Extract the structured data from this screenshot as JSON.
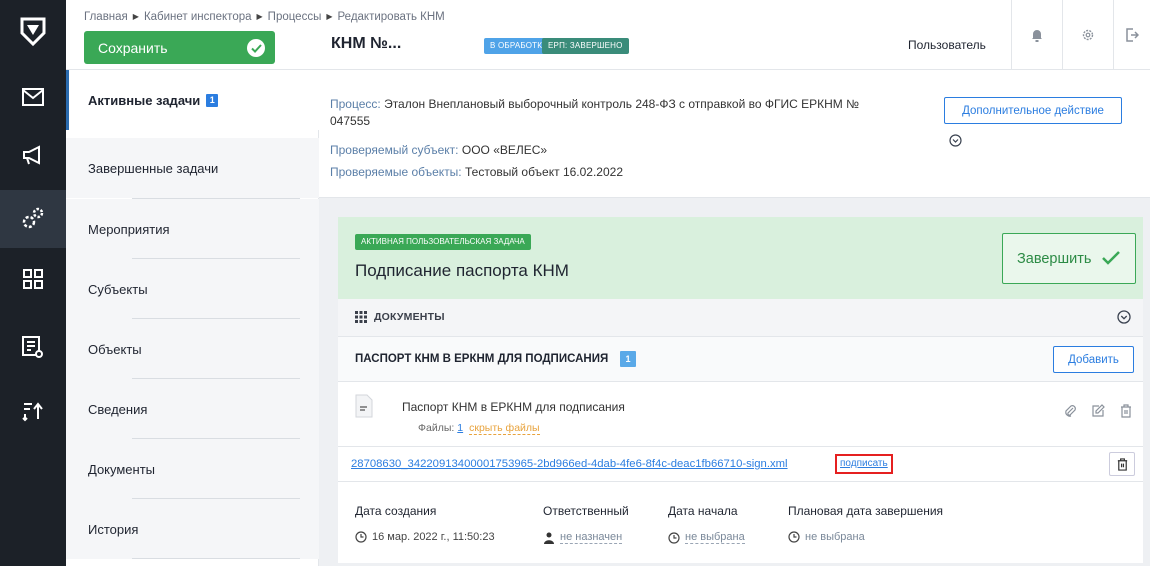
{
  "breadcrumb": [
    "Главная",
    "Кабинет инспектора",
    "Процессы",
    "Редактировать КНМ"
  ],
  "header": {
    "save_label": "Сохранить",
    "title": "КНМ №...",
    "badge_status": "В ОБРАБОТКЕ",
    "badge_erp": "ЕРП: ЗАВЕРШЕНО",
    "user": "Пользователь"
  },
  "rail_icons": [
    "logo-icon",
    "mail-icon",
    "megaphone-icon",
    "gears-icon",
    "grid-icon",
    "report-icon",
    "sort-icon"
  ],
  "nav": [
    {
      "label": "Активные задачи",
      "count": "1"
    },
    {
      "label": "Завершенные задачи"
    },
    {
      "label": "Мероприятия"
    },
    {
      "label": "Субъекты"
    },
    {
      "label": "Объекты"
    },
    {
      "label": "Сведения"
    },
    {
      "label": "Документы"
    },
    {
      "label": "История"
    }
  ],
  "process": {
    "process_label": "Процесс:",
    "process_value": "Эталон Внеплановый выборочный контроль 248-ФЗ с отправкой во ФГИС ЕРКНМ №",
    "process_value_2": "047555",
    "subject_label": "Проверяемый субъект:",
    "subject_value": "ООО «ВЕЛЕС»",
    "objects_label": "Проверяемые объекты:",
    "objects_value": "Тестовый объект 16.02.2022",
    "extra_action": "Дополнительное действие"
  },
  "task": {
    "badge": "АКТИВНАЯ ПОЛЬЗОВАТЕЛЬСКАЯ ЗАДАЧА",
    "title": "Подписание паспорта КНМ",
    "finish": "Завершить",
    "docs_header": "ДОКУМЕНТЫ",
    "section_title": "ПАСПОРТ КНМ В ЕРКНМ ДЛЯ ПОДПИСАНИЯ",
    "section_count": "1",
    "add": "Добавить",
    "doc_name": "Паспорт КНМ в ЕРКНМ для подписания",
    "files_label": "Файлы:",
    "files_count": "1",
    "hide_files": "скрыть файлы",
    "file_name": "28708630_34220913400001753965-2bd966ed-4dab-4fe6-8f4c-deac1fb66710-sign.xml",
    "sign": "подписать"
  },
  "meta": {
    "created_label": "Дата создания",
    "created_value": "16 мар. 2022 г., 11:50:23",
    "resp_label": "Ответственный",
    "resp_value": "не назначен",
    "start_label": "Дата начала",
    "start_value": "не выбрана",
    "plan_label": "Плановая дата завершения",
    "plan_value": "не выбрана"
  },
  "colors": {
    "green": "#3aa856",
    "blue": "#2b7de0",
    "rail": "#1c2128",
    "task_head": "#d9f0dd",
    "highlight": "#e52020"
  }
}
